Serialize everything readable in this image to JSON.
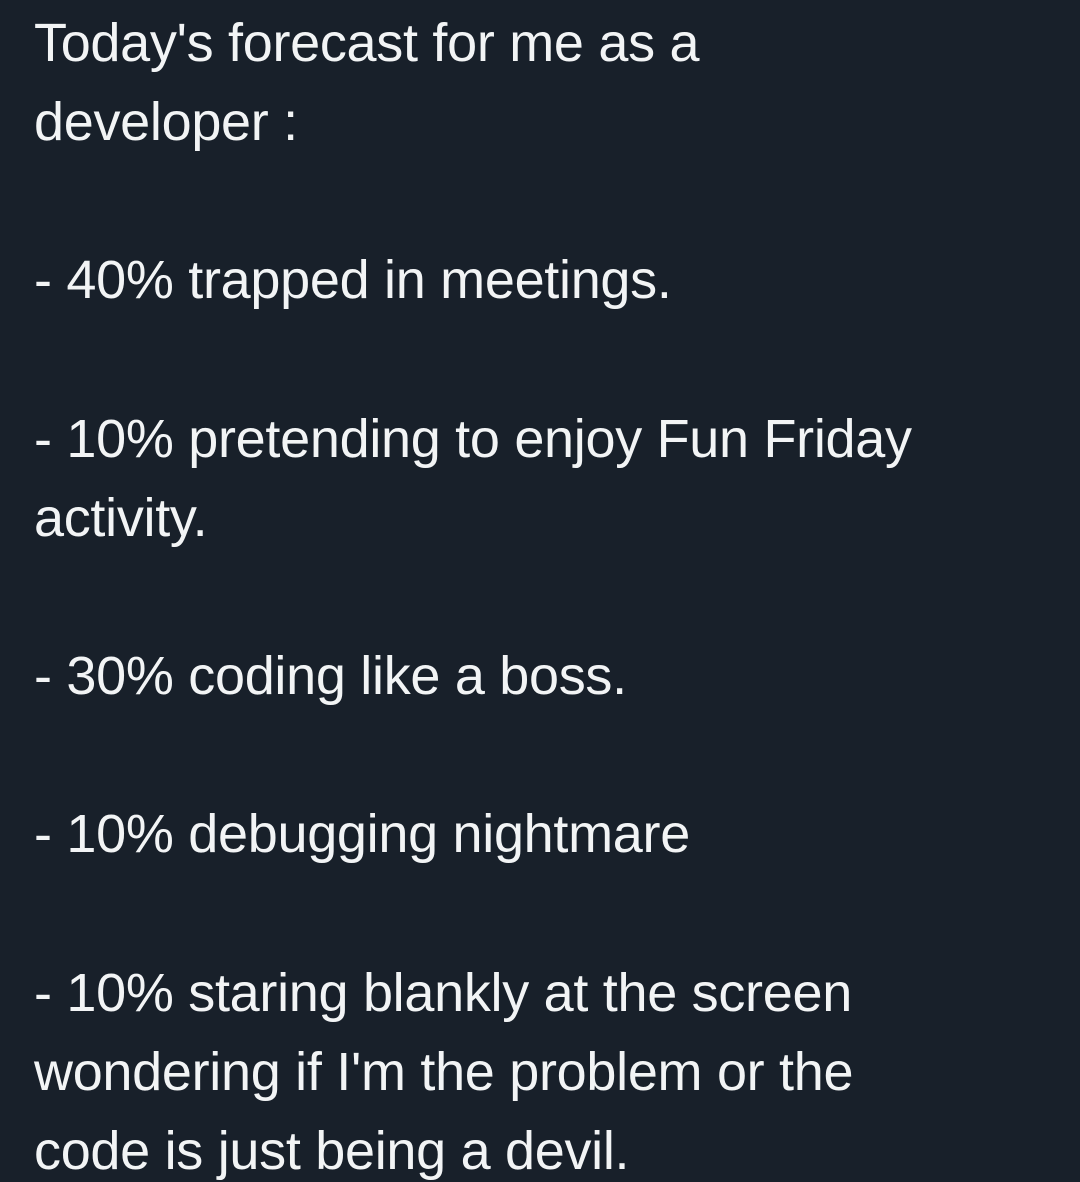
{
  "post": {
    "intro": [
      "Today's forecast for me as a",
      "developer :"
    ],
    "items": [
      {
        "lines": [
          "- 40% trapped in meetings."
        ]
      },
      {
        "lines": [
          "- 10% pretending to enjoy Fun Friday",
          "activity."
        ]
      },
      {
        "lines": [
          "- 30% coding like a boss."
        ]
      },
      {
        "lines": [
          "- 10% debugging nightmare"
        ]
      },
      {
        "lines": [
          "- 10% staring blankly at the screen",
          "wondering if I'm the problem or the",
          "code is just being a devil."
        ]
      }
    ]
  },
  "colors": {
    "background": "#18202a",
    "text": "#f2f4f5"
  }
}
